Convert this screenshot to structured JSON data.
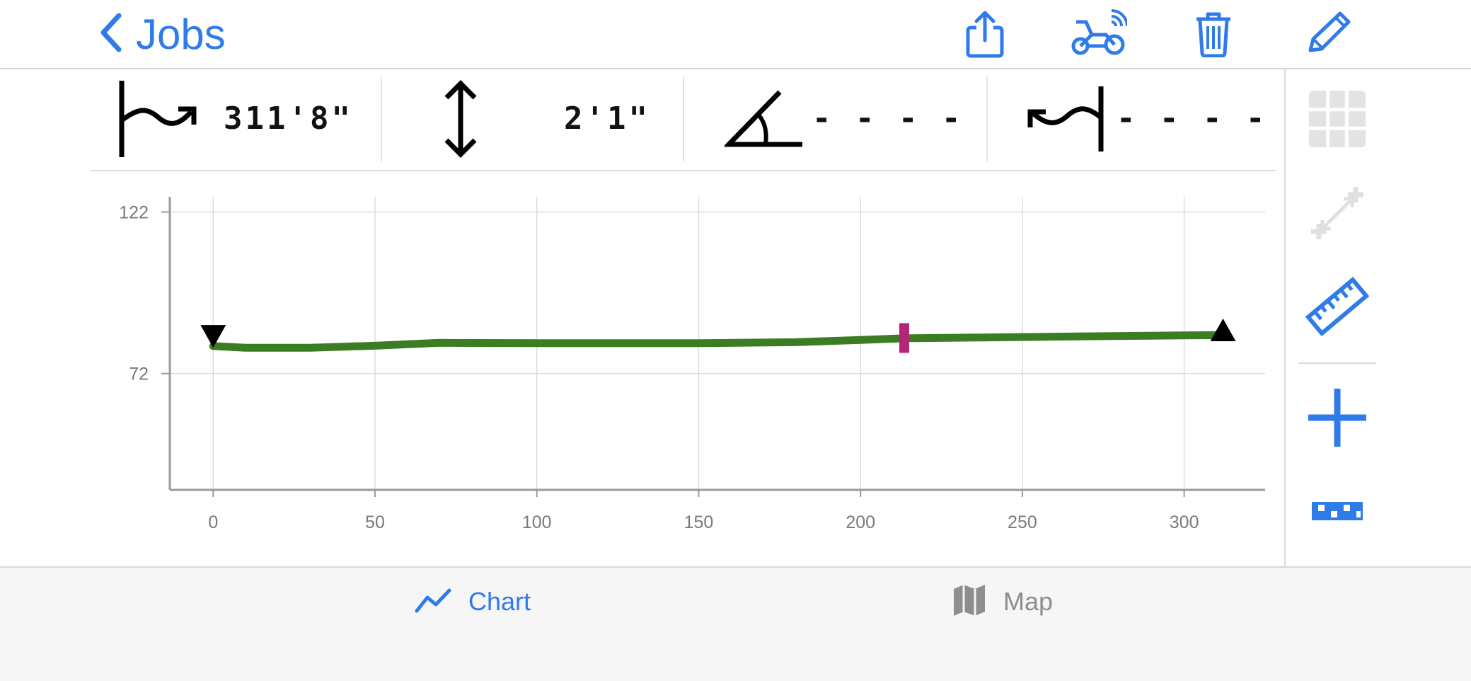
{
  "nav": {
    "back_label": "Jobs",
    "icons": [
      "share-icon",
      "tractor-signal-icon",
      "trash-icon",
      "pencil-icon"
    ],
    "accent": "#2f7bea"
  },
  "stats": {
    "length": "311'8\"",
    "depth": "2'1\"",
    "angle": "- - - -",
    "offset": "- - - -"
  },
  "rail": {
    "icons": [
      "grid-icon",
      "diagonal-plus-icon",
      "ruler-icon",
      "plus-icon",
      "checker-strip-icon"
    ],
    "disabled": [
      "grid-icon",
      "diagonal-plus-icon"
    ]
  },
  "chart_data": {
    "type": "line",
    "x_ticks": [
      0,
      50,
      100,
      150,
      200,
      250,
      300
    ],
    "y_ticks": [
      72,
      122
    ],
    "xlim": [
      -13.4,
      325
    ],
    "ylim": [
      36,
      126.7
    ],
    "grid": true,
    "series": [
      {
        "color": "#3a7d22",
        "x": [
          0,
          10,
          30,
          50,
          70,
          100,
          150,
          180,
          200,
          213.5,
          250,
          300,
          312
        ],
        "y": [
          80.5,
          80.0,
          80.0,
          80.6,
          81.5,
          81.4,
          81.4,
          81.7,
          82.4,
          82.9,
          83.3,
          83.8,
          83.9
        ]
      }
    ],
    "markers": [
      {
        "name": "start-marker",
        "x": 0,
        "y": 83.5,
        "shape": "triangle-down",
        "color": "#000000"
      },
      {
        "name": "end-marker",
        "x": 312,
        "y": 85.5,
        "shape": "triangle-up",
        "color": "#000000"
      },
      {
        "name": "cursor-marker",
        "x": 213.5,
        "y": 83.0,
        "shape": "bar",
        "color": "#b52679"
      }
    ]
  },
  "tabs": [
    {
      "label": "Chart",
      "icon": "line-chart-icon",
      "selected": true
    },
    {
      "label": "Map",
      "icon": "map-icon",
      "selected": false
    }
  ]
}
